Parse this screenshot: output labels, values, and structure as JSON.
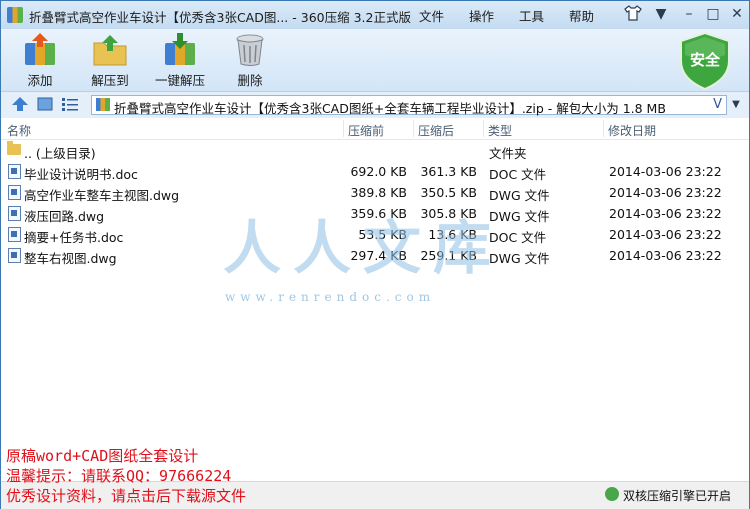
{
  "window": {
    "title": "折叠臂式高空作业车设计【优秀含3张CAD图... - 360压缩 3.2正式版",
    "menus": [
      "文件",
      "操作",
      "工具",
      "帮助"
    ]
  },
  "toolbar": {
    "add": "添加",
    "extract": "解压到",
    "one_click": "一键解压",
    "delete": "删除",
    "security": "安全"
  },
  "address": {
    "path": "折叠臂式高空作业车设计【优秀含3张CAD图纸+全套车辆工程毕业设计】.zip - 解包大小为 1.8 MB"
  },
  "columns": [
    "名称",
    "压缩前",
    "压缩后",
    "类型",
    "修改日期"
  ],
  "files": [
    {
      "name": ".. (上级目录)",
      "before": "",
      "after": "",
      "type": "文件夹",
      "date": "",
      "icon": "folder-icon"
    },
    {
      "name": "毕业设计说明书.doc",
      "before": "692.0 KB",
      "after": "361.3 KB",
      "type": "DOC 文件",
      "date": "2014-03-06 23:22",
      "icon": "doc-file-icon"
    },
    {
      "name": "高空作业车整车主视图.dwg",
      "before": "389.8 KB",
      "after": "350.5 KB",
      "type": "DWG 文件",
      "date": "2014-03-06 23:22",
      "icon": "dwg-file-icon"
    },
    {
      "name": "液压回路.dwg",
      "before": "359.6 KB",
      "after": "305.8 KB",
      "type": "DWG 文件",
      "date": "2014-03-06 23:22",
      "icon": "dwg-file-icon"
    },
    {
      "name": "摘要+任务书.doc",
      "before": "53.5 KB",
      "after": "13.6 KB",
      "type": "DOC 文件",
      "date": "2014-03-06 23:22",
      "icon": "doc-file-icon"
    },
    {
      "name": "整车右视图.dwg",
      "before": "297.4 KB",
      "after": "259.1 KB",
      "type": "DWG 文件",
      "date": "2014-03-06 23:22",
      "icon": "dwg-file-icon"
    }
  ],
  "watermark": {
    "text": "人人文库",
    "url": "www.renrendoc.com"
  },
  "overlay": {
    "line1": "原稿word+CAD图纸全套设计",
    "line2": "温馨提示：请联系QQ：97666224",
    "line3": "优秀设计资料，请点击后下载源文件"
  },
  "status": {
    "engine": "双核压缩引擎已开启"
  }
}
